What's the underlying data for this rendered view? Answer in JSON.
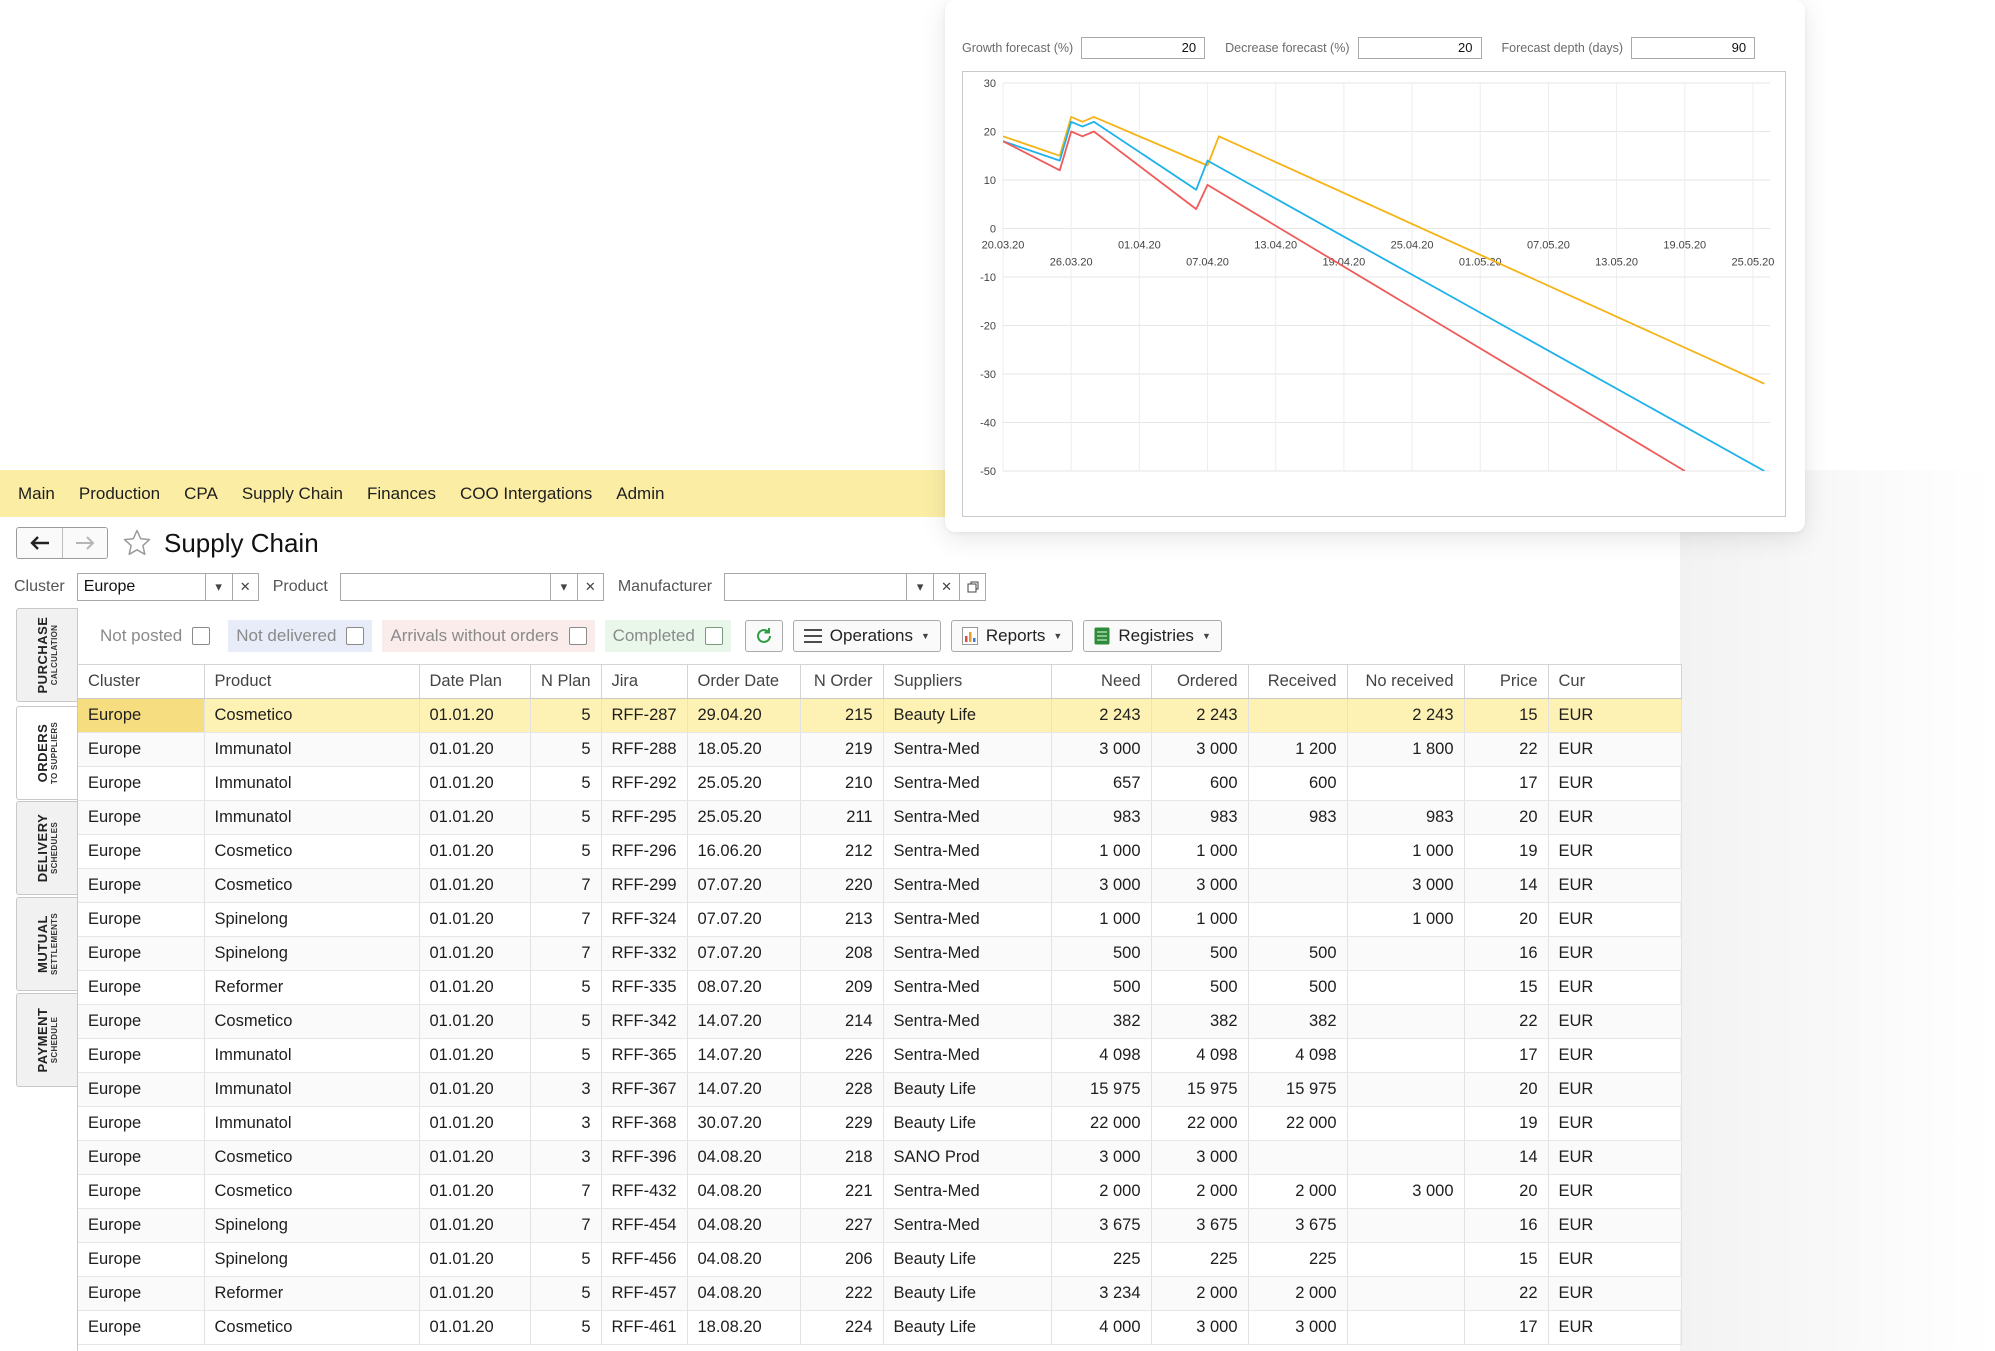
{
  "forecast": {
    "growth_label": "Growth forecast (%)",
    "growth_value": "20",
    "decrease_label": "Decrease forecast (%)",
    "decrease_value": "20",
    "depth_label": "Forecast depth (days)",
    "depth_value": "90"
  },
  "chart_data": {
    "type": "line",
    "title": "",
    "xlabel": "",
    "ylabel": "",
    "x": [
      "20.03.20",
      "26.03.20",
      "01.04.20",
      "07.04.20",
      "13.04.20",
      "19.04.20",
      "25.04.20",
      "01.05.20",
      "07.05.20",
      "13.05.20",
      "19.05.20",
      "25.05.20"
    ],
    "x_tick_labels": [
      "20.03.20",
      "26.03.20",
      "01.04.20",
      "07.04.20",
      "13.04.20",
      "19.04.20",
      "25.04.20",
      "01.05.20",
      "07.05.20",
      "13.05.20",
      "19.05.20",
      "25.05.20"
    ],
    "y_ticks": [
      30,
      20,
      10,
      0,
      -10,
      -20,
      -30,
      -40,
      -50
    ],
    "ylim": [
      -50,
      30
    ],
    "grid": true,
    "series": [
      {
        "color": "#f5b316",
        "points": [
          [
            "20.03.20",
            19
          ],
          [
            "25.03.20",
            15
          ],
          [
            "26.03.20",
            23
          ],
          [
            "27.03.20",
            22
          ],
          [
            "28.03.20",
            23
          ],
          [
            "07.04.20",
            13
          ],
          [
            "08.04.20",
            19
          ],
          [
            "26.05.20",
            -32
          ]
        ]
      },
      {
        "color": "#1fb2ea",
        "points": [
          [
            "20.03.20",
            18
          ],
          [
            "25.03.20",
            14
          ],
          [
            "26.03.20",
            22
          ],
          [
            "27.03.20",
            21
          ],
          [
            "28.03.20",
            22
          ],
          [
            "06.04.20",
            8
          ],
          [
            "07.04.20",
            14
          ],
          [
            "26.05.20",
            -50
          ]
        ]
      },
      {
        "color": "#ef5b5b",
        "points": [
          [
            "20.03.20",
            18
          ],
          [
            "25.03.20",
            12
          ],
          [
            "26.03.20",
            20
          ],
          [
            "27.03.20",
            19
          ],
          [
            "28.03.20",
            20
          ],
          [
            "06.04.20",
            4
          ],
          [
            "07.04.20",
            9
          ],
          [
            "19.05.20",
            -50
          ]
        ]
      }
    ]
  },
  "menu": [
    "Main",
    "Production",
    "CPA",
    "Supply Chain",
    "Finances",
    "COO Intergations",
    "Admin"
  ],
  "page": {
    "title": "Supply Chain"
  },
  "filters": {
    "cluster_label": "Cluster",
    "cluster_value": "Europe",
    "product_label": "Product",
    "product_value": "",
    "manufacturer_label": "Manufacturer",
    "manufacturer_value": ""
  },
  "side_tabs": [
    {
      "big": "PURCHASE",
      "small": "CALCULATION"
    },
    {
      "big": "ORDERS",
      "small": "TO SUPPLIERS"
    },
    {
      "big": "DELIVERY",
      "small": "SCHEDULES"
    },
    {
      "big": "MUTUAL",
      "small": "SETTLEMENTS"
    },
    {
      "big": "PAYMENT",
      "small": "SCHEDULE"
    }
  ],
  "toolbar": {
    "not_posted": "Not posted",
    "not_delivered": "Not delivered",
    "arrivals_without_orders": "Arrivals without orders",
    "completed": "Completed",
    "operations": "Operations",
    "reports": "Reports",
    "registries": "Registries"
  },
  "table": {
    "columns": [
      "Cluster",
      "Product",
      "Date Plan",
      "N Plan",
      "Jira",
      "Order Date",
      "N Order",
      "Suppliers",
      "Need",
      "Ordered",
      "Received",
      "No received",
      "Price",
      "Cur"
    ],
    "rows": [
      [
        "Europe",
        "Cosmetico",
        "01.01.20",
        "5",
        "RFF-287",
        "29.04.20",
        "215",
        "Beauty Life",
        "2 243",
        "2 243",
        "",
        "2 243",
        "15",
        "EUR"
      ],
      [
        "Europe",
        "Immunatol",
        "01.01.20",
        "5",
        "RFF-288",
        "18.05.20",
        "219",
        "Sentra-Med",
        "3 000",
        "3 000",
        "1 200",
        "1 800",
        "22",
        "EUR"
      ],
      [
        "Europe",
        "Immunatol",
        "01.01.20",
        "5",
        "RFF-292",
        "25.05.20",
        "210",
        "Sentra-Med",
        "657",
        "600",
        "600",
        "",
        "17",
        "EUR"
      ],
      [
        "Europe",
        "Immunatol",
        "01.01.20",
        "5",
        "RFF-295",
        "25.05.20",
        "211",
        "Sentra-Med",
        "983",
        "983",
        "983",
        "983",
        "20",
        "EUR"
      ],
      [
        "Europe",
        "Cosmetico",
        "01.01.20",
        "5",
        "RFF-296",
        "16.06.20",
        "212",
        "Sentra-Med",
        "1 000",
        "1 000",
        "",
        "1 000",
        "19",
        "EUR"
      ],
      [
        "Europe",
        "Cosmetico",
        "01.01.20",
        "7",
        "RFF-299",
        "07.07.20",
        "220",
        "Sentra-Med",
        "3 000",
        "3 000",
        "",
        "3 000",
        "14",
        "EUR"
      ],
      [
        "Europe",
        "Spinelong",
        "01.01.20",
        "7",
        "RFF-324",
        "07.07.20",
        "213",
        "Sentra-Med",
        "1 000",
        "1 000",
        "",
        "1 000",
        "20",
        "EUR"
      ],
      [
        "Europe",
        "Spinelong",
        "01.01.20",
        "7",
        "RFF-332",
        "07.07.20",
        "208",
        "Sentra-Med",
        "500",
        "500",
        "500",
        "",
        "16",
        "EUR"
      ],
      [
        "Europe",
        "Reformer",
        "01.01.20",
        "5",
        "RFF-335",
        "08.07.20",
        "209",
        "Sentra-Med",
        "500",
        "500",
        "500",
        "",
        "15",
        "EUR"
      ],
      [
        "Europe",
        "Cosmetico",
        "01.01.20",
        "5",
        "RFF-342",
        "14.07.20",
        "214",
        "Sentra-Med",
        "382",
        "382",
        "382",
        "",
        "22",
        "EUR"
      ],
      [
        "Europe",
        "Immunatol",
        "01.01.20",
        "5",
        "RFF-365",
        "14.07.20",
        "226",
        "Sentra-Med",
        "4 098",
        "4 098",
        "4 098",
        "",
        "17",
        "EUR"
      ],
      [
        "Europe",
        "Immunatol",
        "01.01.20",
        "3",
        "RFF-367",
        "14.07.20",
        "228",
        "Beauty Life",
        "15 975",
        "15 975",
        "15 975",
        "",
        "20",
        "EUR"
      ],
      [
        "Europe",
        "Immunatol",
        "01.01.20",
        "3",
        "RFF-368",
        "30.07.20",
        "229",
        "Beauty Life",
        "22 000",
        "22 000",
        "22 000",
        "",
        "19",
        "EUR"
      ],
      [
        "Europe",
        "Cosmetico",
        "01.01.20",
        "3",
        "RFF-396",
        "04.08.20",
        "218",
        "SANO Prod",
        "3 000",
        "3 000",
        "",
        "",
        "14",
        "EUR"
      ],
      [
        "Europe",
        "Cosmetico",
        "01.01.20",
        "7",
        "RFF-432",
        "04.08.20",
        "221",
        "Sentra-Med",
        "2 000",
        "2 000",
        "2 000",
        "3 000",
        "20",
        "EUR"
      ],
      [
        "Europe",
        "Spinelong",
        "01.01.20",
        "7",
        "RFF-454",
        "04.08.20",
        "227",
        "Sentra-Med",
        "3 675",
        "3 675",
        "3 675",
        "",
        "16",
        "EUR"
      ],
      [
        "Europe",
        "Spinelong",
        "01.01.20",
        "5",
        "RFF-456",
        "04.08.20",
        "206",
        "Beauty Life",
        "225",
        "225",
        "225",
        "",
        "15",
        "EUR"
      ],
      [
        "Europe",
        "Reformer",
        "01.01.20",
        "5",
        "RFF-457",
        "04.08.20",
        "222",
        "Beauty Life",
        "3 234",
        "2 000",
        "2 000",
        "",
        "22",
        "EUR"
      ],
      [
        "Europe",
        "Cosmetico",
        "01.01.20",
        "5",
        "RFF-461",
        "18.08.20",
        "224",
        "Beauty Life",
        "4 000",
        "3 000",
        "3 000",
        "",
        "17",
        "EUR"
      ]
    ]
  }
}
